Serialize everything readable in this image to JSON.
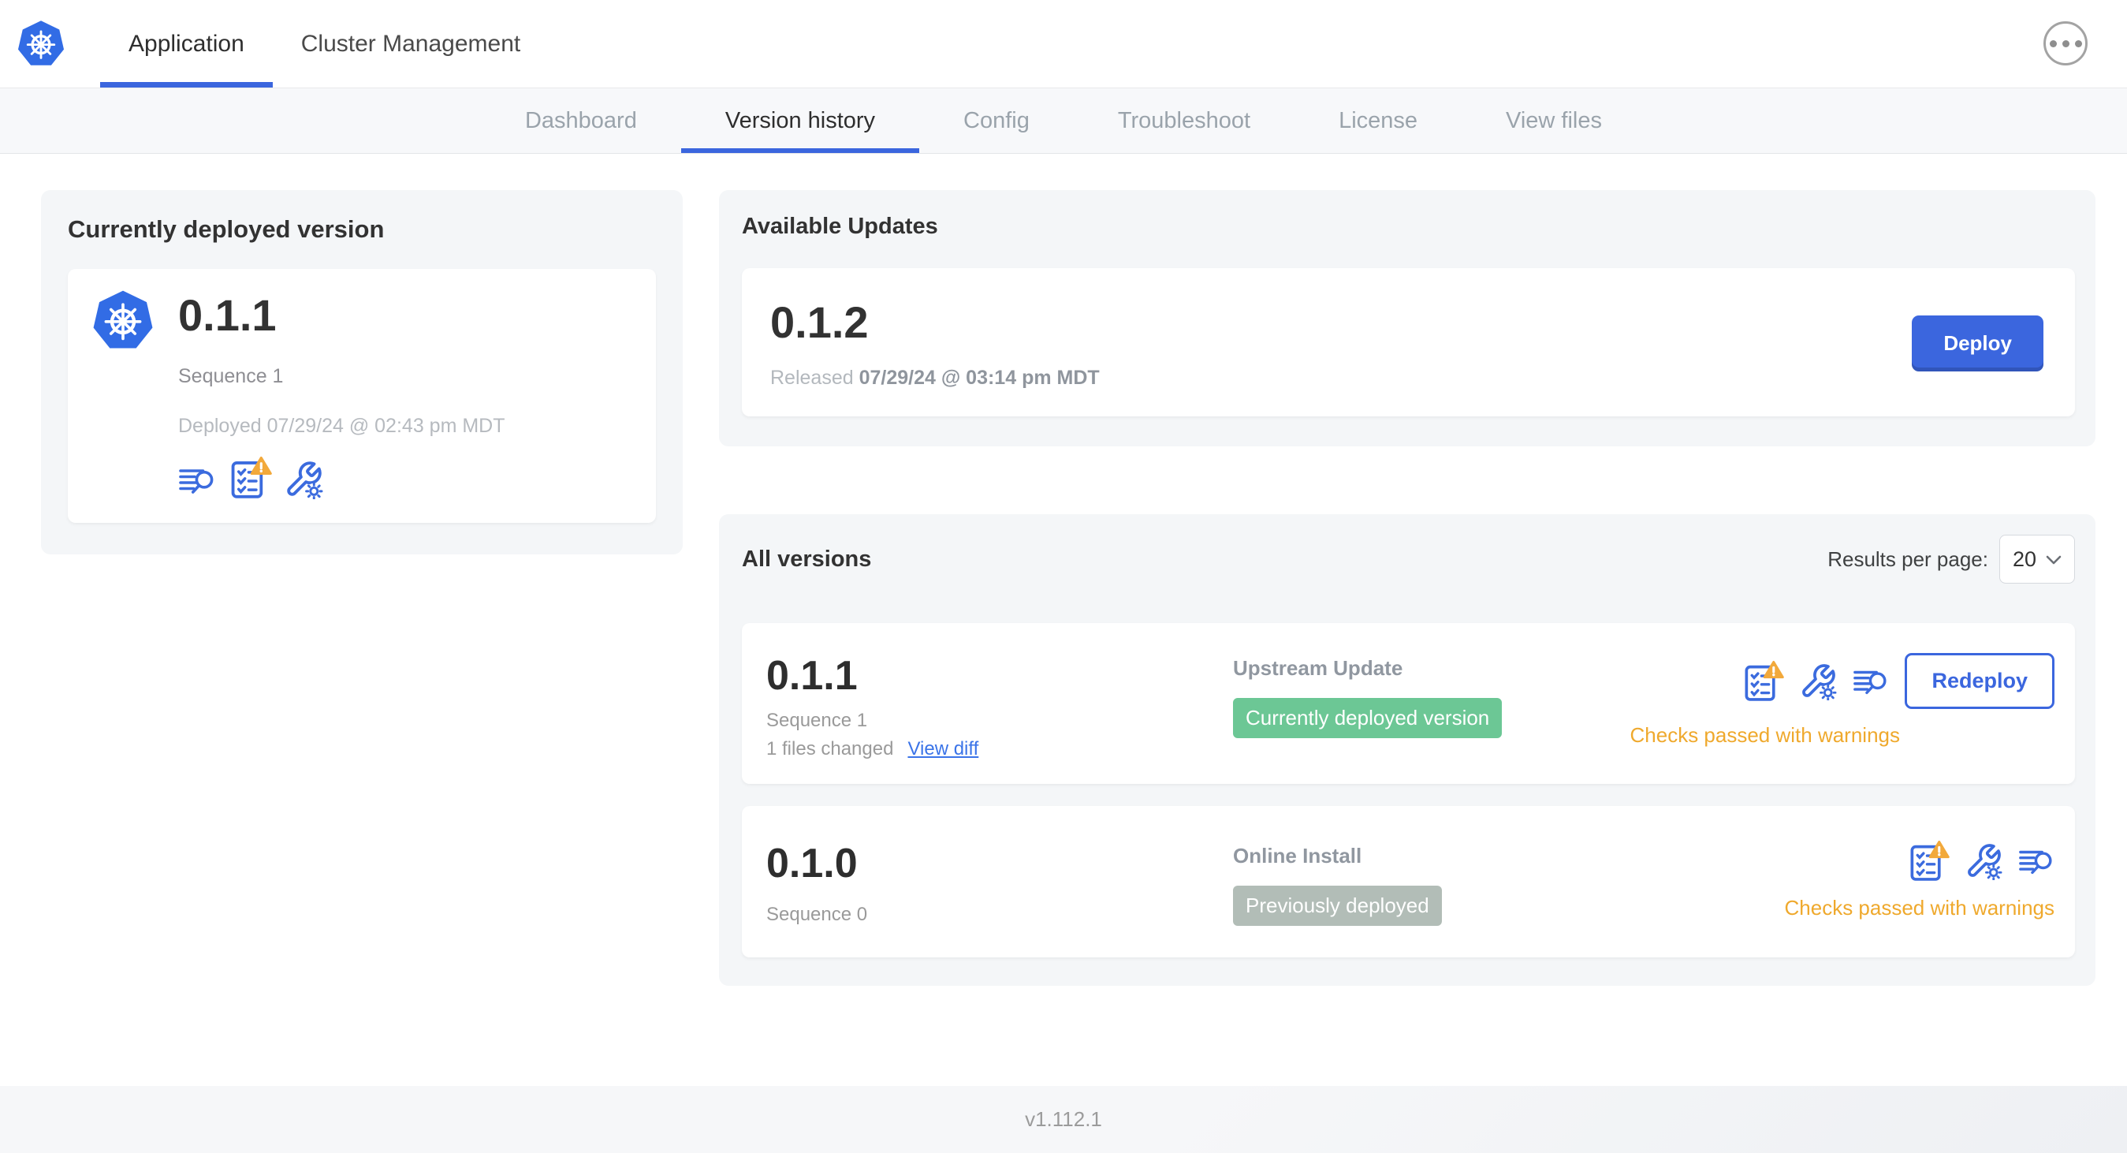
{
  "app": {
    "top_tabs": [
      {
        "label": "Application",
        "active": true
      },
      {
        "label": "Cluster Management",
        "active": false
      }
    ],
    "nav_tabs": [
      "Dashboard",
      "Version history",
      "Config",
      "Troubleshoot",
      "License",
      "View files"
    ],
    "active_nav_tab": "Version history"
  },
  "currently_deployed": {
    "title": "Currently deployed version",
    "version": "0.1.1",
    "sequence": "Sequence 1",
    "deployed_at": "Deployed 07/29/24 @ 02:43 pm MDT"
  },
  "available_updates": {
    "title": "Available Updates",
    "version": "0.1.2",
    "released_prefix": "Released",
    "released_at": "07/29/24 @ 03:14 pm MDT",
    "deploy_label": "Deploy"
  },
  "all_versions": {
    "title": "All versions",
    "results_per_page_label": "Results per page:",
    "results_per_page_value": "20",
    "rows": [
      {
        "version": "0.1.1",
        "sequence": "Sequence 1",
        "files_changed": "1 files changed",
        "view_diff_label": "View diff",
        "source": "Upstream Update",
        "badge": "Currently deployed version",
        "status": "Checks passed with warnings",
        "action_label": "Redeploy"
      },
      {
        "version": "0.1.0",
        "sequence": "Sequence 0",
        "source": "Online Install",
        "badge": "Previously deployed",
        "status": "Checks passed with warnings"
      }
    ]
  },
  "footer": {
    "version": "v1.112.1"
  },
  "icons": {
    "logo": "kubernetes-logo",
    "menu": "ellipsis-menu-icon",
    "logs": "deploy-logs-icon",
    "preflight": "preflight-checks-warning-icon",
    "config": "edit-config-icon",
    "chevron": "chevron-down-icon"
  },
  "colors": {
    "accent_blue": "#3b66de",
    "link_blue": "#3b74e8",
    "icon_blue": "#3b6bde",
    "kubernetes_blue": "#326ce5",
    "warning_orange": "#efa92d",
    "warning_triangle": "#f2a93b",
    "badge_green": "#6cc795",
    "badge_gray": "#b2bdb7",
    "panel_gray": "#f4f6f8"
  }
}
